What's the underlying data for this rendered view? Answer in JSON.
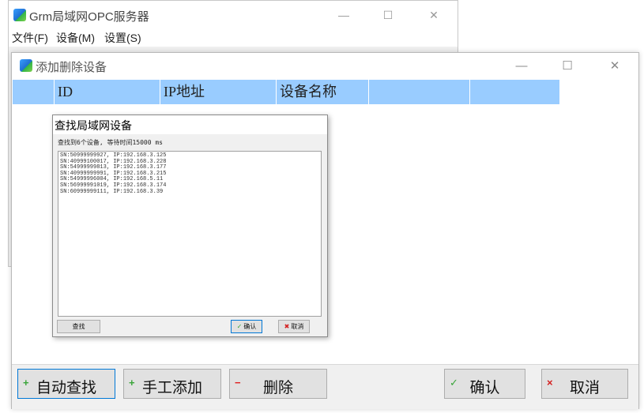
{
  "main_window": {
    "title": "Grm局域网OPC服务器",
    "controls": {
      "minimize": "—",
      "maximize": "☐",
      "close": "✕"
    },
    "menu": [
      "文件(F)",
      "设备(M)",
      "设置(S)"
    ]
  },
  "device_window": {
    "title": "添加删除设备",
    "controls": {
      "minimize": "—",
      "maximize": "☐",
      "close": "✕"
    },
    "columns": [
      "ID",
      "IP地址",
      "设备名称",
      "",
      ""
    ],
    "buttons": {
      "auto_search": {
        "label": "自动查找",
        "glyph": "+"
      },
      "manual_add": {
        "label": "手工添加",
        "glyph": "+"
      },
      "delete": {
        "label": "删除",
        "glyph": "−"
      },
      "confirm": {
        "label": "确认",
        "glyph": "✓"
      },
      "cancel": {
        "label": "取消",
        "glyph": "×"
      }
    }
  },
  "search_dialog": {
    "title": "查找局域网设备",
    "status": "查找到6个设备, 等待时间15000 ms",
    "results": [
      "SN:50999999927, IP:192.168.3.125",
      "SN:40999100017, IP:192.168.3.228",
      "SN:54999999813, IP:192.168.3.177",
      "SN:40999999991, IP:192.168.3.215",
      "SN:54999996004, IP:192.168.5.11",
      "SN:56999991019, IP:192.168.3.174",
      "SN:60999999111, IP:192.168.3.39"
    ],
    "buttons": {
      "search": "查找",
      "confirm": "确认",
      "cancel": "取消"
    }
  },
  "colors": {
    "header_bg": "#99ccff",
    "focus_border": "#0078d7",
    "plus": "#3aa53a",
    "minus": "#e02020",
    "check": "#3aa53a",
    "cross": "#d42020"
  }
}
